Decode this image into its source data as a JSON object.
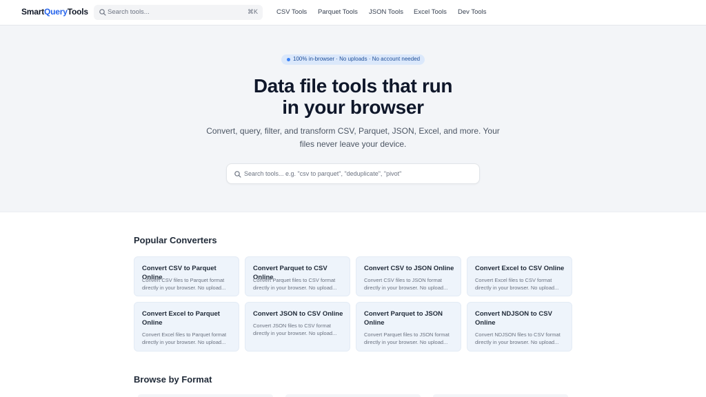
{
  "header": {
    "logo_part1": "Smart",
    "logo_part2": "Query",
    "logo_part3": "Tools",
    "search_placeholder": "Search tools...",
    "search_shortcut": "⌘K",
    "nav": [
      "CSV Tools",
      "Parquet Tools",
      "JSON Tools",
      "Excel Tools",
      "Dev Tools"
    ]
  },
  "hero": {
    "badge": "100% in-browser · No uploads · No account needed",
    "title_line1": "Data file tools that run",
    "title_line2": "in your browser",
    "subtitle_line1": "Convert, query, filter, and transform CSV, Parquet, JSON, Excel, and more. Your",
    "subtitle_line2": "files never leave your device.",
    "search_placeholder": "Search tools... e.g. \"csv to parquet\", \"deduplicate\", \"pivot\""
  },
  "popular": {
    "title": "Popular Converters",
    "cards": [
      {
        "title": "Convert CSV to Parquet Online",
        "desc1": "Convert CSV files to Parquet format",
        "desc2": "directly in your browser. No upload..."
      },
      {
        "title": "Convert Parquet to CSV Online",
        "desc1": "Convert Parquet files to CSV format",
        "desc2": "directly in your browser. No upload..."
      },
      {
        "title": "Convert CSV to JSON Online",
        "desc1": "Convert CSV files to JSON format",
        "desc2": "directly in your browser. No upload..."
      },
      {
        "title": "Convert Excel to CSV Online",
        "desc1": "Convert Excel files to CSV format",
        "desc2": "directly in your browser. No upload..."
      },
      {
        "title": "Convert Excel to Parquet Online",
        "desc1": "Convert Excel files to Parquet format",
        "desc2": "directly in your browser. No upload..."
      },
      {
        "title": "Convert JSON to CSV Online",
        "desc1": "Convert JSON files to CSV format",
        "desc2": "directly in your browser. No upload..."
      },
      {
        "title": "Convert Parquet to JSON Online",
        "desc1": "Convert Parquet files to JSON format",
        "desc2": "directly in your browser. No upload..."
      },
      {
        "title": "Convert NDJSON to CSV Online",
        "desc1": "Convert NDJSON files to CSV format",
        "desc2": "directly in your browser. No upload..."
      }
    ]
  },
  "browse": {
    "title": "Browse by Format"
  },
  "colors": {
    "accent": "#2563eb",
    "hero_bg": "#f3f5f8",
    "card_bg": "#eef4fb",
    "badge_bg": "#dbe8fb"
  },
  "icons": {
    "search": "search-icon"
  }
}
